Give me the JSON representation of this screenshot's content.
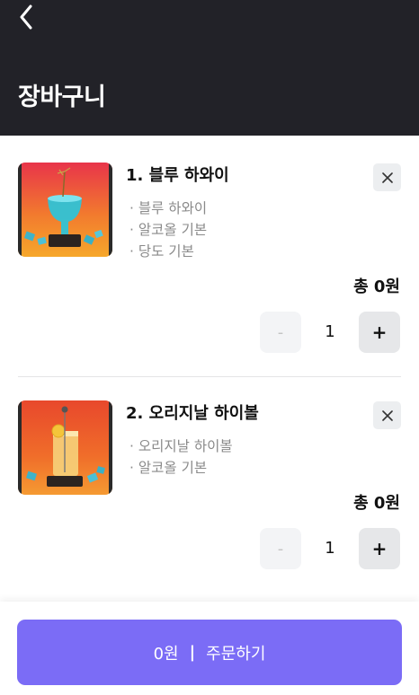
{
  "header": {
    "back_icon": "chevron-left-icon",
    "title": "장바구니",
    "background": "#222228"
  },
  "cart": {
    "items": [
      {
        "name": "1. 블루 하와이",
        "options": [
          "블루 하와이",
          "알코올 기본",
          "당도 기본"
        ],
        "total": "총 0원",
        "quantity": "1",
        "minus_label": "-",
        "plus_label": "+",
        "remove_icon": "close-icon",
        "image": "blue-hawaii-cocktail-photo"
      },
      {
        "name": "2. 오리지날 하이볼",
        "options": [
          "오리지날 하이볼",
          "알코올 기본"
        ],
        "total": "총 0원",
        "quantity": "1",
        "minus_label": "-",
        "plus_label": "+",
        "remove_icon": "close-icon",
        "image": "original-highball-photo"
      }
    ]
  },
  "order_button": {
    "price": "0원",
    "separator": "|",
    "label": "주문하기",
    "color": "#7b6cf6"
  }
}
